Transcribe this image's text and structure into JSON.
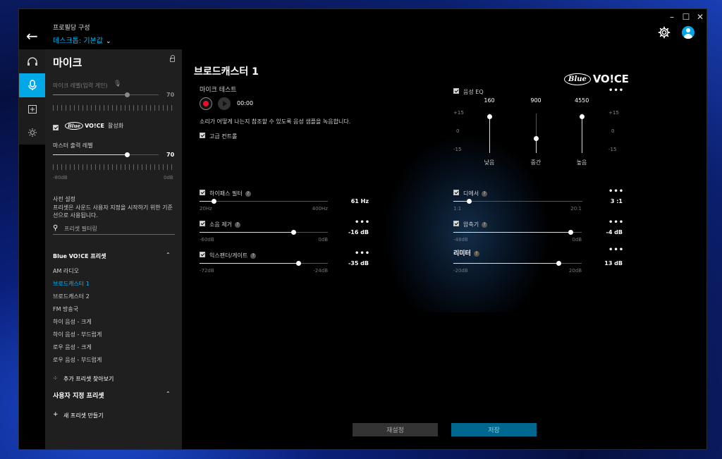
{
  "window_controls": [
    "–",
    "☐",
    "✕"
  ],
  "header": {
    "back_icon": "←",
    "title": "프로필당 구성",
    "profile": "데스크톱: 기본값"
  },
  "sidebar_rail": [
    {
      "name": "headphones",
      "icon": "🎧",
      "active": false
    },
    {
      "name": "microphone",
      "icon": "🎙",
      "active": true
    },
    {
      "name": "add",
      "icon": "⊞",
      "active": false
    },
    {
      "name": "lighting",
      "icon": "☀",
      "active": false
    }
  ],
  "panel": {
    "title": "마이크",
    "mic_level_label": "마이크 레벨(입력 게인)",
    "mic_level_value": "70",
    "mic_level_fraction": 0.7,
    "bluevoice_label": "활성화",
    "bluevoice_logo": "Blue",
    "bluevoice_logo2": "VO!CE",
    "master_label": "마스터 출력 레벨",
    "master_value": "70",
    "master_fraction": 0.7,
    "master_min": "-80dB",
    "master_max": "0dB",
    "preset_heading": "사전 설정",
    "preset_desc": "프리셋은 사운드 사용자 지정을 시작하기 위한 기준선으로 사용됩니다.",
    "filter_placeholder": "프리셋 필터링",
    "bluevoice_presets_title": "Blue VO!CE 프리셋",
    "presets": [
      "AM 라디오",
      "브로드캐스터 1",
      "브로드캐스터 2",
      "FM 방송국",
      "하이 음성 - 크게",
      "하이 음성 - 부드럽게",
      "로우 음성 - 크게",
      "로우 음성 - 부드럽게"
    ],
    "selected_preset_index": 1,
    "find_more": "추가 프리셋 찾아보기",
    "custom_presets_title": "사용자 지정 프리셋",
    "new_preset": "새 프리셋 만들기"
  },
  "main": {
    "title": "브로드캐스터 1",
    "mic_test_label": "마이크 테스트",
    "time": "00:00",
    "mic_test_desc": "소리가 어떻게 나는지 참조할 수 있도록 음성 샘플을 녹음합니다.",
    "advanced_label": "고급 컨트롤",
    "logo_blue": "Blue",
    "logo_voice": "VO!CE",
    "eq": {
      "label": "음성 EQ",
      "bands": [
        {
          "freq": "160",
          "name": "낮음",
          "level": 0.92
        },
        {
          "freq": "900",
          "name": "중간",
          "level": 0.38
        },
        {
          "freq": "4550",
          "name": "높음",
          "level": 0.92
        }
      ],
      "scale_top": "+15",
      "scale_mid": "0",
      "scale_bot": "-15"
    },
    "highpass": {
      "label": "하이패스 필터",
      "value": "61 Hz",
      "min": "20Hz",
      "max": "400Hz",
      "fraction": 0.11
    },
    "denoise": {
      "label": "소음 제거",
      "value": "-16 dB",
      "min": "-60dB",
      "max": "0dB",
      "fraction": 0.73
    },
    "expander": {
      "label": "익스팬더/게이트",
      "value": "-35 dB",
      "min": "-72dB",
      "max": "-24dB",
      "fraction": 0.77
    },
    "deesser": {
      "label": "디에서",
      "value": "3 :1",
      "min": "1:1",
      "max": "20:1",
      "fraction": 0.12
    },
    "compressor": {
      "label": "압축기",
      "value": "-4 dB",
      "min": "-48dB",
      "max": "0dB",
      "fraction": 0.91
    },
    "limiter": {
      "label": "리미터",
      "value": "13 dB",
      "min": "-20dB",
      "max": "20dB",
      "fraction": 0.82
    },
    "more_icon": "•••",
    "help": "?"
  },
  "buttons": {
    "reset": "재설정",
    "save": "저장"
  },
  "colors": {
    "accent": "#00a8e8",
    "record": "#e8112d"
  }
}
